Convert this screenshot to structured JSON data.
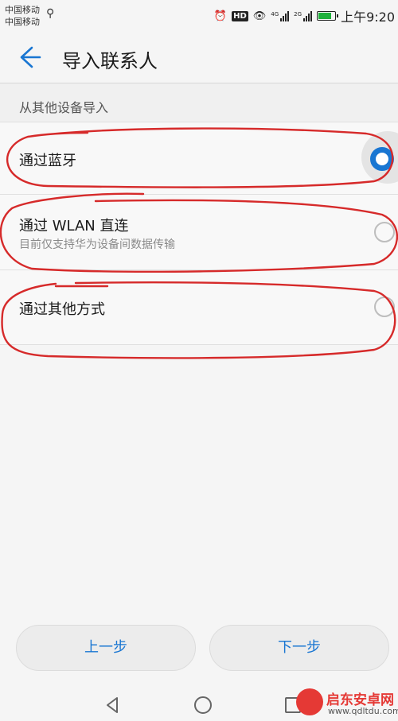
{
  "status_bar": {
    "carrier_1": "中国移动",
    "carrier_2": "中国移动",
    "hd_badge": "HD",
    "sig1_label": "4G",
    "sig2_label": "2G",
    "time": "上午9:20",
    "battery_level": 0.9,
    "icons": [
      "usb-icon",
      "alarm-icon",
      "hd-icon",
      "eye-comfort-icon",
      "signal-4g-icon",
      "signal-2g-icon",
      "battery-icon"
    ]
  },
  "toolbar": {
    "back_icon": "back-arrow-icon",
    "title": "导入联系人"
  },
  "section": {
    "header": "从其他设备导入"
  },
  "options": [
    {
      "label": "通过蓝牙",
      "selected": true
    },
    {
      "label": "通过 WLAN 直连",
      "sublabel": "目前仅支持华为设备间数据传输",
      "selected": false
    },
    {
      "label": "通过其他方式",
      "selected": false
    }
  ],
  "buttons": {
    "prev": "上一步",
    "next": "下一步"
  },
  "nav_bar": {
    "icons": [
      "nav-back-icon",
      "nav-home-icon",
      "nav-recent-icon"
    ]
  },
  "watermark": {
    "title": "启东安卓网",
    "url": "www.qdltdu.com"
  },
  "colors": {
    "accent": "#1976d2",
    "annotation": "#d62a2a",
    "background": "#f5f5f5"
  }
}
